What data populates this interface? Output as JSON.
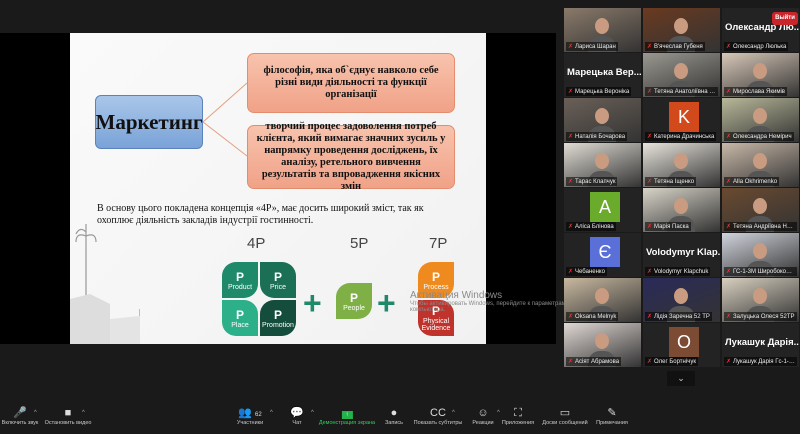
{
  "slide": {
    "title": "Маркетинг",
    "definition1": "філософія, яка об`єднує навколо себе різні види діяльності та функції організації",
    "definition2": "творчий процес задоволення потреб клієнта, який вимагає значних зусиль у напрямку проведення досліджень, їх аналізу, ретельного вивчення результатів та впровадження якісних змін",
    "paragraph": "В основу цього покладена концепція «4Р», має досить широкий зміст, так як охоплює діяльність закладів індустрії гостинності.",
    "label_4p": "4P",
    "label_5p": "5P",
    "label_7p": "7P",
    "p_letter": "P",
    "leaves": {
      "product": "Product",
      "price": "Price",
      "place": "Place",
      "promotion": "Promotion",
      "people": "People",
      "process": "Process",
      "physical": "Physical Evidence"
    },
    "plus": "+",
    "watermark_title": "Активация Windows",
    "watermark_text": "Чтобы активировать Windows, перейдите к параметрам компьютера."
  },
  "participants": [
    {
      "name": "Лариса Шаран",
      "type": "video",
      "color": "#8a7a6a"
    },
    {
      "name": "В'ячеслав Губеня",
      "type": "video",
      "color": "#6a3a20"
    },
    {
      "name": "Олександр Люлька",
      "type": "name",
      "display": "Олександр Лю..."
    },
    {
      "name": "Марецька Вероніка",
      "type": "name",
      "display": "Марецька Вер..."
    },
    {
      "name": "Тетяна Анатоліївна Силь...",
      "type": "video",
      "color": "#9a9890"
    },
    {
      "name": "Мирослава Якимів",
      "type": "video",
      "color": "#d8c8b8"
    },
    {
      "name": "Наталія Бочарова",
      "type": "video",
      "color": "#6a6058"
    },
    {
      "name": "Катерина Драчинська",
      "type": "avatar",
      "letter": "K",
      "color": "#d2491b"
    },
    {
      "name": "Олександра Немірич",
      "type": "video",
      "color": "#b8b89a"
    },
    {
      "name": "Тарас Клапчук",
      "type": "video",
      "color": "#e0dcd4"
    },
    {
      "name": "Тетяна Іщенко",
      "type": "video",
      "color": "#e8e4dc"
    },
    {
      "name": "Alla Okhrimenko",
      "type": "video",
      "color": "#c8b8a8"
    },
    {
      "name": "Аліса Блінова",
      "type": "avatar",
      "letter": "A",
      "color": "#6bab2b"
    },
    {
      "name": "Марія Паска",
      "type": "video",
      "color": "#d8d4c8"
    },
    {
      "name": "Тетяна Андріївна На...",
      "type": "video",
      "color": "#6a4a30"
    },
    {
      "name": "Чебаненко",
      "type": "avatar",
      "letter": "Є",
      "color": "#5a6fd8"
    },
    {
      "name": "Volodymyr Klapchuk",
      "type": "name",
      "display": "Volodymyr Klap..."
    },
    {
      "name": "ГС-1-3М Широбокова А...",
      "type": "video",
      "color": "#d0d4dc"
    },
    {
      "name": "Oksana Melnyk",
      "type": "video",
      "color": "#c8b8a0"
    },
    {
      "name": "Лідія Заречна 52 ТР",
      "type": "video",
      "color": "#2a2a5a"
    },
    {
      "name": "Залуцька Олеся 52ТР",
      "type": "video",
      "color": "#d8d0c0",
      "active": true
    },
    {
      "name": "Асіят Абрамова",
      "type": "video",
      "color": "#e0d8d4"
    },
    {
      "name": "Олег Бортнічук",
      "type": "avatar",
      "letter": "O",
      "color": "#7b4b33"
    },
    {
      "name": "Лукашук Дарія Гс-1-9а",
      "type": "name",
      "display": "Лукашук Дарія..."
    }
  ],
  "gallery_more": "⌄",
  "toolbar": [
    {
      "id": "unmute",
      "label": "Включить звук",
      "icon": "🎤",
      "caret": true
    },
    {
      "id": "stop-video",
      "label": "Остановить видео",
      "icon": "■",
      "caret": true
    },
    {
      "id": "participants",
      "label": "Участники",
      "icon": "👥",
      "count": "62",
      "caret": true
    },
    {
      "id": "chat",
      "label": "Чат",
      "icon": "💬",
      "caret": true
    },
    {
      "id": "share-screen",
      "label": "Демонстрация экрана",
      "icon": "↑",
      "green": true
    },
    {
      "id": "record",
      "label": "Запись",
      "icon": "●"
    },
    {
      "id": "captions",
      "label": "Показать субтитры",
      "icon": "CC",
      "caret": true
    },
    {
      "id": "reactions",
      "label": "Реакции",
      "icon": "☺",
      "caret": true
    },
    {
      "id": "apps",
      "label": "Приложения",
      "icon": "⛶"
    },
    {
      "id": "whiteboards",
      "label": "Доски сообщений",
      "icon": "▭"
    },
    {
      "id": "notes",
      "label": "Примечания",
      "icon": "✎"
    }
  ],
  "leave_label": "Выйти",
  "colors": {
    "accent_green": "#24b34b",
    "leave_red": "#c9262b",
    "active_border": "#b6d84a"
  }
}
